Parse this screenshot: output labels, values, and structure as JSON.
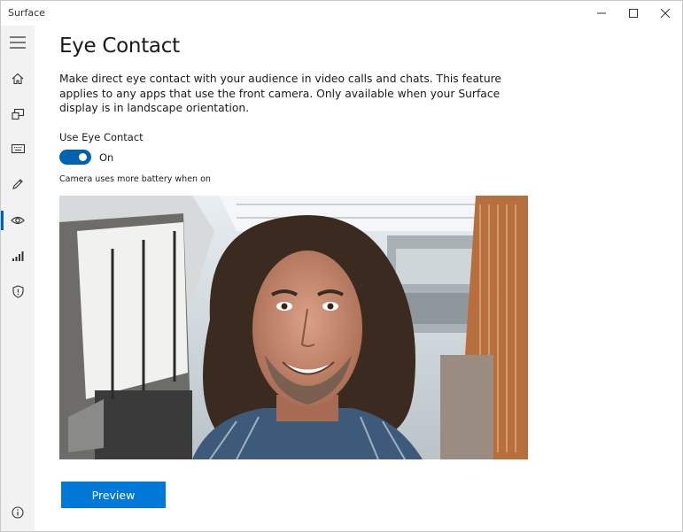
{
  "window": {
    "title": "Surface",
    "controls": [
      "minimize",
      "maximize",
      "close"
    ]
  },
  "sidebar": {
    "items": [
      {
        "icon": "hamburger-menu-icon"
      },
      {
        "icon": "home-icon"
      },
      {
        "icon": "devices-icon"
      },
      {
        "icon": "keyboard-icon"
      },
      {
        "icon": "pen-icon"
      },
      {
        "icon": "eye-icon",
        "active": true
      },
      {
        "icon": "signal-bars-icon"
      },
      {
        "icon": "shield-icon"
      },
      {
        "icon": "info-icon"
      }
    ]
  },
  "main": {
    "title": "Eye Contact",
    "description": "Make direct eye contact with your audience in video calls and chats. This feature applies to any apps that use the front camera. Only available when your Surface display is in landscape orientation.",
    "toggle": {
      "label": "Use Eye Contact",
      "state": "On",
      "on": true
    },
    "battery_note": "Camera uses more battery when on",
    "preview_button": "Preview"
  },
  "colors": {
    "accent": "#0078d7",
    "toggle_on": "#0063b1",
    "sidebar_bg": "#f2f2f2"
  }
}
